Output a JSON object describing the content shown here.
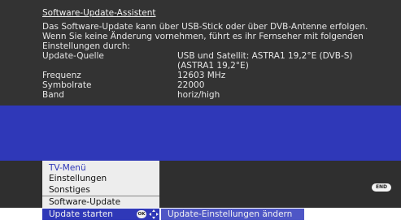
{
  "info": {
    "title": "Software-Update-Assistent",
    "description_lines": [
      "Das Software-Update kann über USB-Stick oder über DVB-Antenne erfolgen.",
      "Wenn Sie keine Änderung vornehmen, führt es ihr Fernseher mit folgenden",
      "Einstellungen durch:"
    ],
    "rows": [
      {
        "label": "Update-Quelle",
        "value": "USB und Satellit: ASTRA1 19,2°E (DVB-S)",
        "value2": "(ASTRA1 19,2°E)"
      },
      {
        "label": "Frequenz",
        "value": "12603 MHz"
      },
      {
        "label": "Symbolrate",
        "value": "22000"
      },
      {
        "label": "Band",
        "value": "horiz/high"
      }
    ]
  },
  "menu": {
    "title": "TV-Menü",
    "items": [
      "Einstellungen",
      "Sonstiges",
      "Software-Update"
    ]
  },
  "end_key": "END",
  "footer": {
    "left_label": "Update starten",
    "ok_key": "OK",
    "right_label": "Update-Einstellungen ändern"
  },
  "colors": {
    "panel": "#333333",
    "blue": "#2f38b8",
    "menu_bg": "#ededed"
  }
}
